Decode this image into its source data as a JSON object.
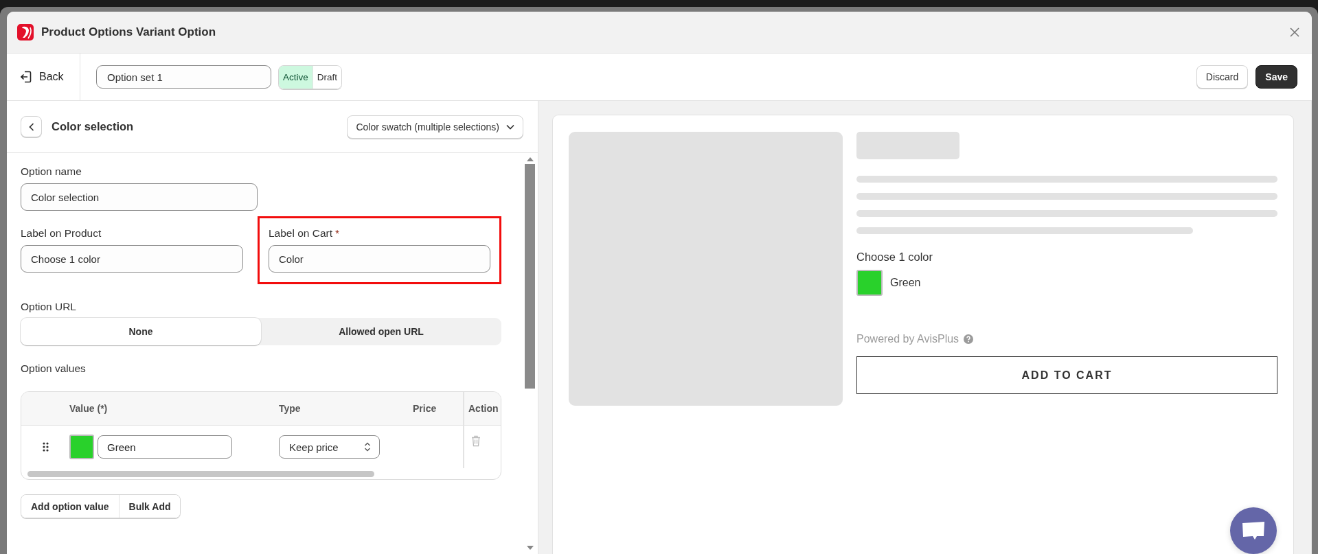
{
  "window": {
    "title": "Product Options Variant Option"
  },
  "toolbar": {
    "back": "Back",
    "set_name": "Option set 1",
    "status": [
      {
        "label": "Active",
        "selected": true
      },
      {
        "label": "Draft",
        "selected": false
      }
    ],
    "buttons": [
      {
        "label": "Discard",
        "kind": "secondary"
      },
      {
        "label": "Save",
        "kind": "primary"
      }
    ]
  },
  "editor": {
    "title": "Color selection",
    "type_select": "Color swatch (multiple selections)",
    "fields": [
      {
        "label": "Option name",
        "value": "Color selection",
        "highlighted": false
      },
      {
        "label": "Label on Product",
        "value": "Choose 1 color",
        "highlighted": false
      },
      {
        "label": "Label on Cart",
        "required_mark": "*",
        "value": "Color",
        "highlighted": true
      }
    ],
    "option_url": {
      "label": "Option URL",
      "choices": [
        {
          "label": "None",
          "selected": true
        },
        {
          "label": "Allowed open URL",
          "selected": false
        }
      ]
    },
    "option_values": {
      "label": "Option values",
      "columns": [
        "Value (*)",
        "Type",
        "Price",
        "Action"
      ],
      "rows": [
        {
          "color": "#29d12b",
          "value": "Green",
          "type": "Keep price"
        }
      ]
    },
    "actions": [
      "Add option value",
      "Bulk Add"
    ]
  },
  "preview": {
    "label": "Choose 1 color",
    "swatches": [
      {
        "color": "#29d12b",
        "name": "Green"
      }
    ],
    "powered_by": "Powered by AvisPlus",
    "add_to_cart": "ADD TO CART"
  }
}
